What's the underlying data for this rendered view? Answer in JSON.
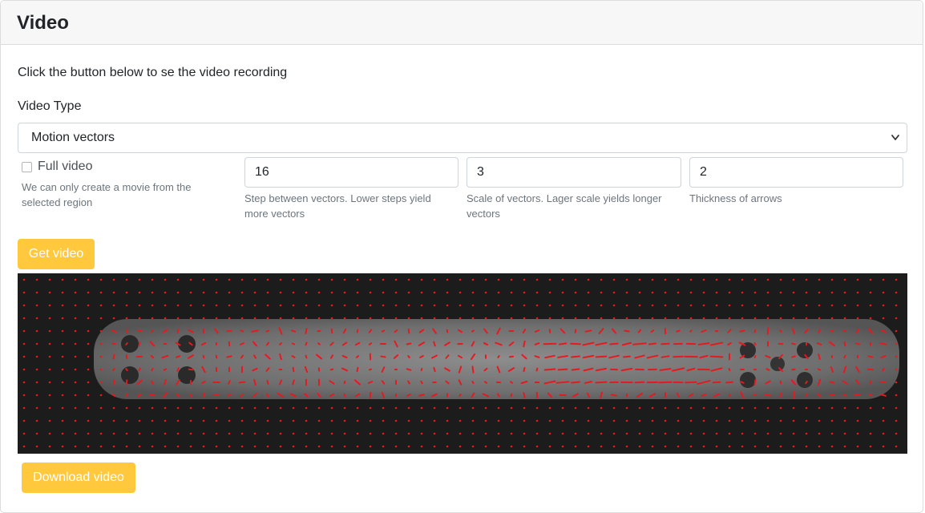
{
  "header": {
    "title": "Video"
  },
  "intro_text": "Click the button below to se the video recording",
  "video_type": {
    "label": "Video Type",
    "selected": "Motion vectors",
    "chevron_icon": "chevron-down-icon"
  },
  "full_video": {
    "label": "Full video",
    "checked": false,
    "help": "We can only create a movie from the selected region"
  },
  "step": {
    "value": "16",
    "help": "Step between vectors. Lower steps yield more vectors"
  },
  "scale": {
    "value": "3",
    "help": "Scale of vectors. Lager scale yields longer vectors"
  },
  "thickness": {
    "value": "2",
    "help": "Thickness of arrows"
  },
  "buttons": {
    "get_video": "Get video",
    "download_video": "Download video"
  },
  "colors": {
    "button": "#ffc83d",
    "vector": "#e8191e",
    "frame_background": "#1a1a1a"
  }
}
